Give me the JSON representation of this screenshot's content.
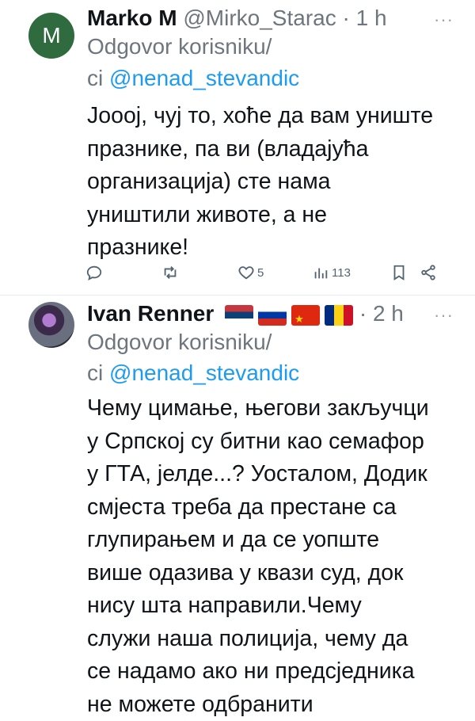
{
  "tweets": [
    {
      "avatar_letter": "M",
      "name": "Marko M",
      "handle": "@Mirko_Starac",
      "dot": "·",
      "time": "1 h",
      "reply_prefix": "Odgovor korisniku/",
      "reply_ci": "ci",
      "reply_mention": "@nenad_stevandic",
      "text": "Joooj, чуј то, хоће да вам униште\nпразнике, па ви (владајућа\nорганизација) сте нама\nуништили животе, а не\nпразнике!",
      "likes": "5",
      "views": "113"
    },
    {
      "name": "Ivan Renner",
      "flags": [
        "serbia-flag",
        "russia-flag",
        "china-flag",
        "romania-flag"
      ],
      "dot": "·",
      "time": "2 h",
      "reply_prefix": "Odgovor korisniku/",
      "reply_ci": "ci",
      "reply_mention": "@nenad_stevandic",
      "text": "Чему цимање, његови закључци\nу Српској су битни као семафор\nу ГТА, јелде...? Уосталом, Додик\nсмјеста треба да престане са\nглупирањем и да се уопште\nвише одазива у квази суд, док\nнису шта направили.Чему\nслужи наша полиција, чему да\nсе надамо ако ни предсједника\nне можете одбранити"
    }
  ],
  "more_label": "···"
}
